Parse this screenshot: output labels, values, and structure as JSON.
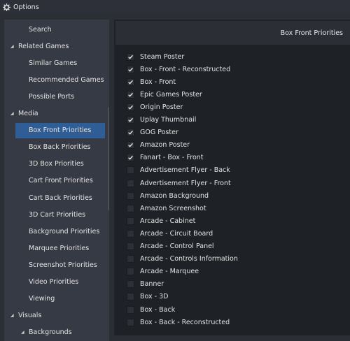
{
  "window": {
    "title": "Options",
    "icon": "gear-icon"
  },
  "sidebar": {
    "items": [
      {
        "label": "Search",
        "type": "sub"
      },
      {
        "label": "Related Games",
        "type": "group"
      },
      {
        "label": "Similar Games",
        "type": "sub"
      },
      {
        "label": "Recommended Games",
        "type": "sub"
      },
      {
        "label": "Possible Ports",
        "type": "sub"
      },
      {
        "label": "Media",
        "type": "group"
      },
      {
        "label": "Box Front Priorities",
        "type": "selected"
      },
      {
        "label": "Box Back Priorities",
        "type": "sub"
      },
      {
        "label": "3D Box Priorities",
        "type": "sub"
      },
      {
        "label": "Cart Front Priorities",
        "type": "sub"
      },
      {
        "label": "Cart Back Priorities",
        "type": "sub"
      },
      {
        "label": "3D Cart Priorities",
        "type": "sub"
      },
      {
        "label": "Background Priorities",
        "type": "sub"
      },
      {
        "label": "Marquee Priorities",
        "type": "sub"
      },
      {
        "label": "Screenshot Priorities",
        "type": "sub"
      },
      {
        "label": "Video Priorities",
        "type": "sub"
      },
      {
        "label": "Viewing",
        "type": "sub"
      },
      {
        "label": "Visuals",
        "type": "group"
      },
      {
        "label": "Backgrounds",
        "type": "nested"
      }
    ]
  },
  "main": {
    "header_title": "Box Front Priorities",
    "priorities": [
      {
        "label": "Steam Poster",
        "checked": true
      },
      {
        "label": "Box - Front - Reconstructed",
        "checked": true
      },
      {
        "label": "Box - Front",
        "checked": true
      },
      {
        "label": "Epic Games Poster",
        "checked": true
      },
      {
        "label": "Origin Poster",
        "checked": true
      },
      {
        "label": "Uplay Thumbnail",
        "checked": true
      },
      {
        "label": "GOG Poster",
        "checked": true
      },
      {
        "label": "Amazon Poster",
        "checked": true
      },
      {
        "label": "Fanart - Box - Front",
        "checked": true
      },
      {
        "label": "Advertisement Flyer - Back",
        "checked": false
      },
      {
        "label": "Advertisement Flyer - Front",
        "checked": false
      },
      {
        "label": "Amazon Background",
        "checked": false
      },
      {
        "label": "Amazon Screenshot",
        "checked": false
      },
      {
        "label": "Arcade - Cabinet",
        "checked": false
      },
      {
        "label": "Arcade - Circuit Board",
        "checked": false
      },
      {
        "label": "Arcade - Control Panel",
        "checked": false
      },
      {
        "label": "Arcade - Controls Information",
        "checked": false
      },
      {
        "label": "Arcade - Marquee",
        "checked": false
      },
      {
        "label": "Banner",
        "checked": false
      },
      {
        "label": "Box - 3D",
        "checked": false
      },
      {
        "label": "Box - Back",
        "checked": false
      },
      {
        "label": "Box - Back - Reconstructed",
        "checked": false
      }
    ]
  }
}
